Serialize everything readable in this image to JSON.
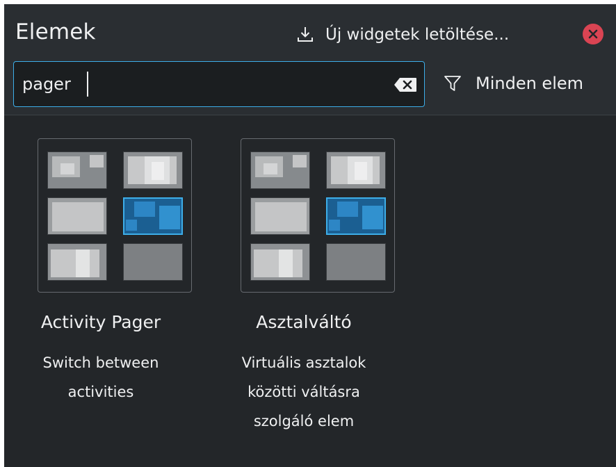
{
  "header": {
    "title": "Elemek",
    "get_new_label": "Új widgetek letöltése...",
    "get_new_icon": "download-icon",
    "close_icon": "close-icon"
  },
  "search": {
    "value": "pager",
    "placeholder": "",
    "clear_icon": "clear-text-icon"
  },
  "filter": {
    "label": "Minden elem",
    "icon": "filter-icon"
  },
  "widgets": [
    {
      "name": "Activity Pager",
      "description": "Switch between\nactivities",
      "icon": "pager-icon"
    },
    {
      "name": "Asztalváltó",
      "description": "Virtuális asztalok\nközötti váltásra\nszolgáló elem",
      "icon": "pager-icon"
    }
  ],
  "colors": {
    "panel_bg": "#232629",
    "header_bg": "#2a2e32",
    "accent": "#3daee9",
    "active_desktop": "#2d86c5",
    "close": "#da4453",
    "text": "#eff0f1"
  }
}
